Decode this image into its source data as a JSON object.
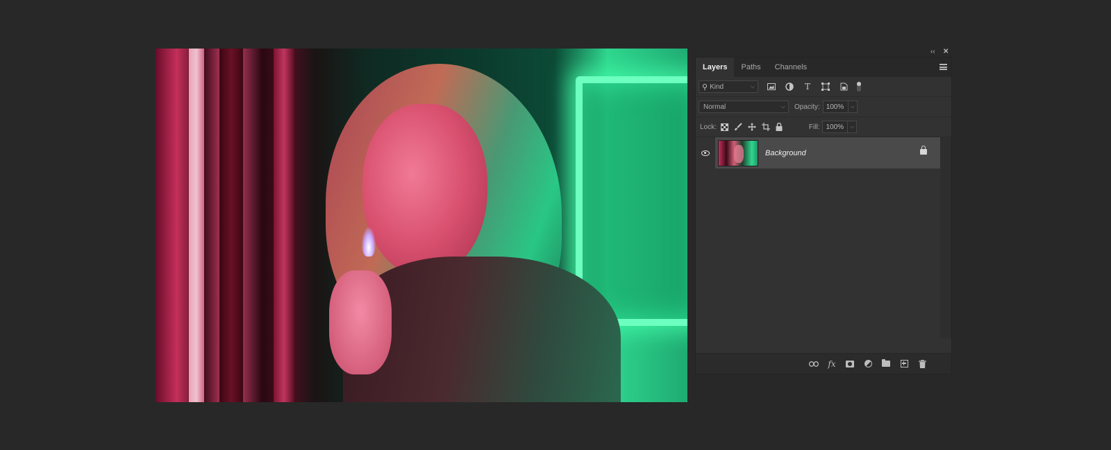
{
  "panel": {
    "tabs": [
      {
        "label": "Layers",
        "active": true
      },
      {
        "label": "Paths",
        "active": false
      },
      {
        "label": "Channels",
        "active": false
      }
    ],
    "filter": {
      "kind_label": "Kind",
      "icons": [
        "pixel-layer-filter-icon",
        "adjustment-filter-icon",
        "type-filter-icon",
        "shape-filter-icon",
        "smart-object-filter-icon"
      ]
    },
    "blend_mode": "Normal",
    "opacity_label": "Opacity:",
    "opacity_value": "100%",
    "lock_label": "Lock:",
    "fill_label": "Fill:",
    "fill_value": "100%",
    "layers": [
      {
        "name": "Background",
        "visible": true,
        "locked": true
      }
    ],
    "footer_icons": [
      "link-layers-icon",
      "fx-icon",
      "add-mask-icon",
      "adjustment-layer-icon",
      "group-folder-icon",
      "new-layer-icon",
      "delete-layer-icon"
    ],
    "fx_label": "fx"
  },
  "glyphs": {
    "collapse": "‹‹",
    "close": "✕",
    "chevron": "⌵",
    "search": "⚲",
    "type": "T",
    "lock": "🔒",
    "link": "⊖",
    "trash": "🗑"
  }
}
